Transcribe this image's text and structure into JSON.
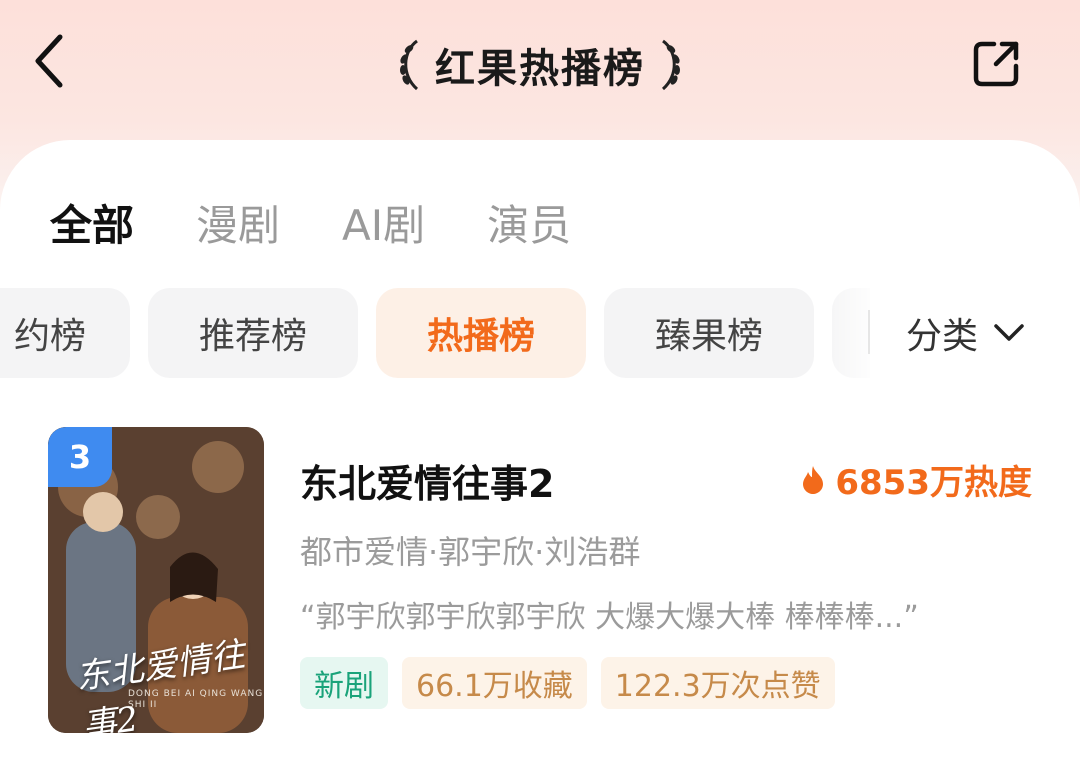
{
  "header": {
    "title": "红果热播榜",
    "back_icon": "chevron-left-icon",
    "share_icon": "share-icon"
  },
  "tabs": [
    {
      "label": "全部",
      "active": true
    },
    {
      "label": "漫剧",
      "active": false
    },
    {
      "label": "AI剧",
      "active": false
    },
    {
      "label": "演员",
      "active": false
    }
  ],
  "chips": [
    {
      "label": "约榜",
      "active": false
    },
    {
      "label": "推荐榜",
      "active": false
    },
    {
      "label": "热播榜",
      "active": true
    },
    {
      "label": "臻果榜",
      "active": false
    }
  ],
  "category": {
    "label": "分类",
    "icon": "chevron-down-icon"
  },
  "item": {
    "rank": "3",
    "title": "东北爱情往事2",
    "heat": "6853万热度",
    "heat_icon": "flame-icon",
    "meta": "都市爱情·郭宇欣·刘浩群",
    "quote": "“郭宇欣郭宇欣郭宇欣 大爆大爆大棒 棒棒棒...”",
    "poster_title": "东北爱情往事2",
    "poster_subtitle": "DONG BEI AI QING WANG SHI II",
    "tags": [
      {
        "label": "新剧",
        "type": "new"
      },
      {
        "label": "66.1万收藏",
        "type": "stat"
      },
      {
        "label": "122.3万次点赞",
        "type": "stat"
      }
    ]
  },
  "colors": {
    "accent": "#f26a1b",
    "rank_badge": "#3f8bf0",
    "new_tag": "#1aa37a",
    "stat_tag": "#c68a4a"
  }
}
